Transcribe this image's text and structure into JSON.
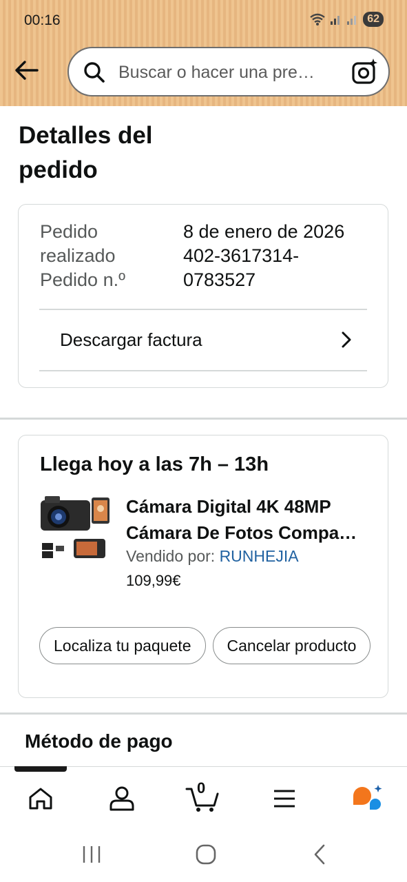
{
  "status_bar": {
    "time": "00:16",
    "battery": "62"
  },
  "header": {
    "search_placeholder": "Buscar o hacer una pre…"
  },
  "page": {
    "title": "Detalles del pedido"
  },
  "order_info": {
    "placed_label_line1": "Pedido",
    "placed_label_line2": "realizado",
    "number_label": "Pedido n.º",
    "placed_value": "8 de enero de 2026",
    "number_value_line1": "402-3617314-",
    "number_value_line2": "0783527",
    "invoice_label": "Descargar factura"
  },
  "delivery": {
    "title": "Llega hoy a las 7h – 13h",
    "product_line1": "Cámara Digital 4K 48MP",
    "product_line2": "Cámara De Fotos Compa…",
    "seller_prefix": "Vendido por:",
    "seller_name": "RUNHEJIA",
    "price": "109,99€",
    "buttons": {
      "track": "Localiza tu paquete",
      "cancel": "Cancelar producto"
    }
  },
  "payment": {
    "title": "Método de pago"
  },
  "bottom_nav": {
    "cart_count": "0"
  },
  "colors": {
    "header_bg": "#efc48f",
    "link": "#2162a1",
    "text": "#0f1111",
    "secondary_text": "#565959",
    "assistant_orange": "#f3761c",
    "assistant_blue": "#1a8fe3"
  },
  "icons": [
    "back-arrow-icon",
    "search-icon",
    "camera-lens-icon",
    "chevron-right-icon",
    "home-icon",
    "account-icon",
    "cart-icon",
    "menu-icon",
    "rufus-assistant-icon"
  ]
}
